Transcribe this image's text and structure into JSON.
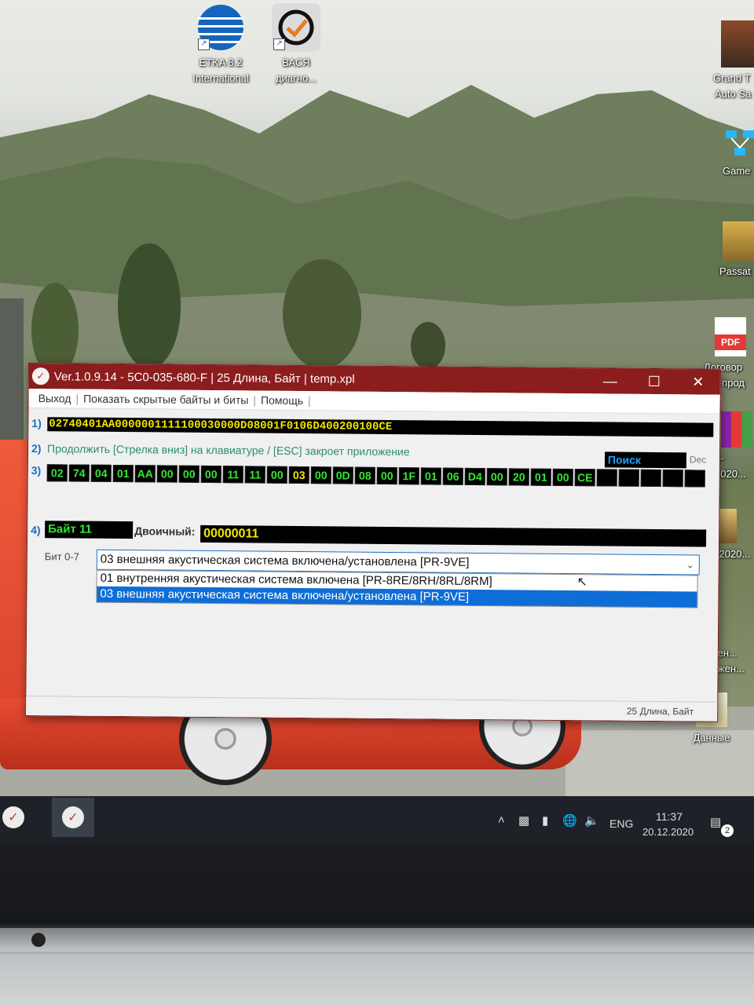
{
  "desktop": {
    "icons": [
      {
        "id": "etka",
        "label_line1": "ETKA 8.2",
        "label_line2": "International"
      },
      {
        "id": "vasya",
        "label_line1": "ВАСЯ",
        "label_line2": "диагно..."
      },
      {
        "id": "grand",
        "label_line1": "Grand T",
        "label_line2": "Auto Sa"
      },
      {
        "id": "game",
        "label_line1": "Game"
      },
      {
        "id": "passat",
        "label_line1": "Passat"
      },
      {
        "id": "dogovor",
        "label_line1": "Договор",
        "label_line2": "ли-прод"
      },
      {
        "id": "file1",
        "label_line1": "1-2020..."
      },
      {
        "id": "file2",
        "label_line1": "1-2020..."
      },
      {
        "id": "saved",
        "label_line1": "ранен...",
        "label_line2": "бражен..."
      },
      {
        "id": "data",
        "label_line1": "Данные"
      }
    ],
    "pdf_badge": "PDF"
  },
  "window": {
    "title": "Ver.1.0.9.14 -   5C0-035-680-F | 25 Длина, Байт | temp.xpl",
    "menu": [
      "Выход",
      "Показать скрытые байты и биты",
      "Помощь"
    ],
    "row_numbers": [
      "1)",
      "2)",
      "3)",
      "4)"
    ],
    "raw_hex": "02740401AA0000001111100030000D08001F0106D400200100CE",
    "instruction": "Продолжить [Стрелка вниз] на клавиатуре / [ESC] закроет приложение",
    "search_label": "Поиск",
    "dec_label": "Dec",
    "bytes": [
      "02",
      "74",
      "04",
      "01",
      "AA",
      "00",
      "00",
      "00",
      "11",
      "11",
      "00",
      "03",
      "00",
      "0D",
      "08",
      "00",
      "1F",
      "01",
      "06",
      "D4",
      "00",
      "20",
      "01",
      "00",
      "CE"
    ],
    "selected_byte_index": 11,
    "empty_cells": 5,
    "byte_label": "Байт 11",
    "binary_label": "Двоичный:",
    "binary_value": "00000011",
    "bit_label": "Бит 0-7",
    "bit_select_value": "03 внешняя акустическая система включена/установлена [PR-9VE]",
    "dropdown_options": [
      "01 внутренняя акустическая система включена [PR-8RE/8RH/8RL/8RM]",
      "03 внешняя акустическая система включена/установлена [PR-9VE]"
    ],
    "active_option_index": 1,
    "status": "25 Длина, Байт"
  },
  "taskbar": {
    "language": "ENG",
    "time": "11:37",
    "date": "20.12.2020",
    "notification_count": "2"
  },
  "colors": {
    "title_bar": "#8b1d1d",
    "hex_yellow": "#f2e600",
    "byte_green": "#31e831",
    "selection_blue": "#0e6dd6"
  }
}
